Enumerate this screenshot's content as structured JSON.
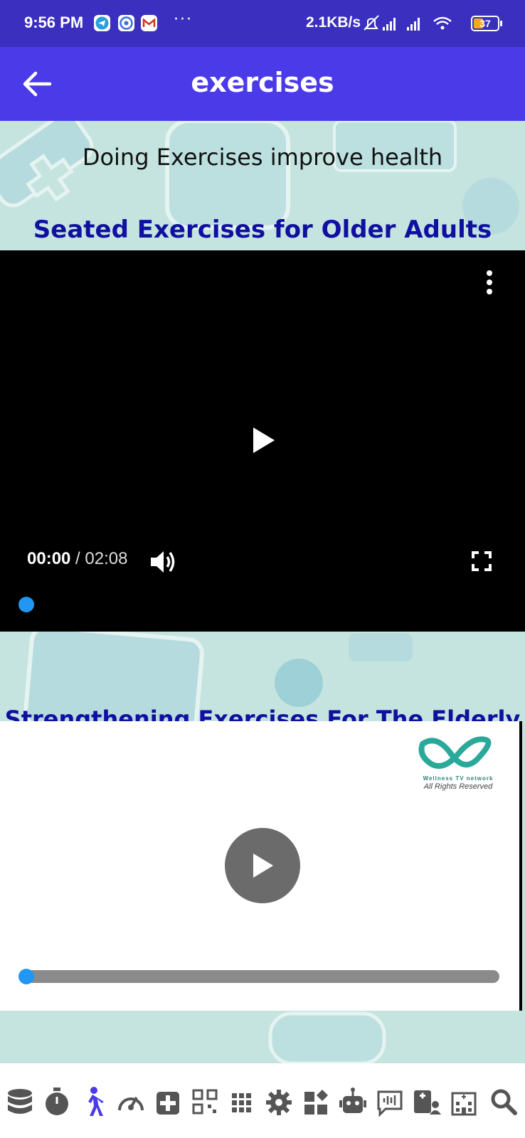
{
  "status_bar": {
    "time": "9:56 PM",
    "dots": "···",
    "net_speed": "2.1KB/s",
    "battery": "37"
  },
  "app_bar": {
    "title": "exercises",
    "back_icon": "arrow-left-icon"
  },
  "content": {
    "headline": "Doing Exercises improve health",
    "video1": {
      "title": "Seated Exercises for Older Adults",
      "current_time": "00:00",
      "separator": " / ",
      "duration": "02:08",
      "progress": 0
    },
    "video2": {
      "title": "Strengthening Exercises For The Elderly",
      "watermark_line1": "Wellness TV network",
      "watermark_line2": "All Rights Reserved",
      "progress": 0
    }
  },
  "colors": {
    "status_bar": "#3a2fbe",
    "app_bar": "#4b3ae8",
    "background": "#c6e4df",
    "title_blue": "#1010a0",
    "progress_blue": "#2196f3"
  },
  "bottom_nav": [
    {
      "icon": "database-icon"
    },
    {
      "icon": "stopwatch-icon"
    },
    {
      "icon": "walking-person-icon"
    },
    {
      "icon": "gauge-icon"
    },
    {
      "icon": "medical-plus-icon"
    },
    {
      "icon": "qr-code-icon"
    },
    {
      "icon": "grid-icon"
    },
    {
      "icon": "gear-icon"
    },
    {
      "icon": "widgets-icon"
    },
    {
      "icon": "robot-icon"
    },
    {
      "icon": "voice-chat-icon"
    },
    {
      "icon": "patient-card-icon"
    },
    {
      "icon": "hospital-icon"
    },
    {
      "icon": "search-icon"
    }
  ]
}
